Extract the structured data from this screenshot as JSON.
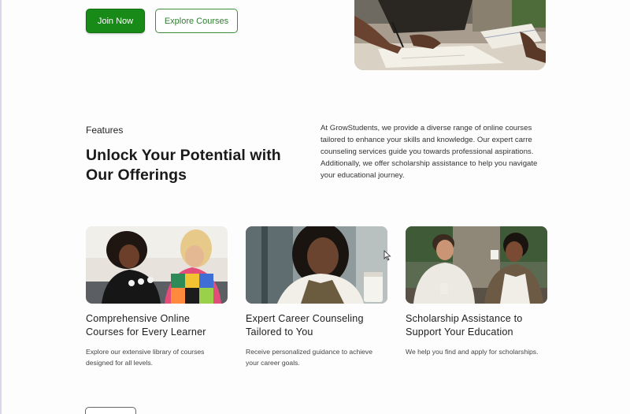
{
  "hero": {
    "join_label": "Join Now",
    "explore_label": "Explore Courses"
  },
  "features": {
    "eyebrow": "Features",
    "headline": "Unlock Your Potential with Our Offerings",
    "intro": "At GrowStudents, we provide a diverse range of online courses tailored to enhance your skills and knowledge. Our expert carre counseling services guide you towards professional aspirations. Additionally, we offer scholarship assistance to help you navigate your educational journey."
  },
  "cards": [
    {
      "title": "Comprehensive Online Courses for Every Learner",
      "desc": "Explore our extensive library of courses designed for all levels."
    },
    {
      "title": "Expert Career Counseling Tailored to You",
      "desc": "Receive personalized guidance to achieve your career goals."
    },
    {
      "title": "Scholarship Assistance to Support Your Education",
      "desc": "We help you find and apply for scholarships."
    }
  ],
  "colors": {
    "primary": "#178a17",
    "outline": "#3d8d3d"
  }
}
